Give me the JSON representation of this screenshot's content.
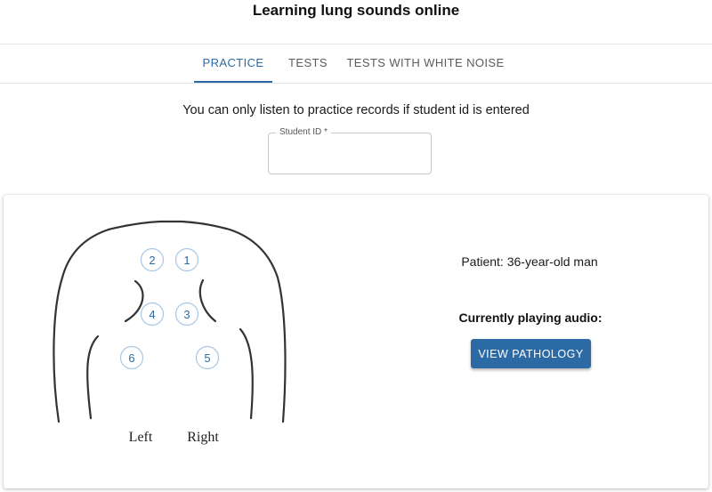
{
  "app": {
    "title": "Learning lung sounds online"
  },
  "tabs": [
    {
      "label": "PRACTICE",
      "active": true
    },
    {
      "label": "TESTS",
      "active": false
    },
    {
      "label": "TESTS WITH WHITE NOISE",
      "active": false
    }
  ],
  "practice": {
    "instruction": "You can only listen to practice records if student id is entered",
    "student_id": {
      "label": "Student ID *",
      "value": ""
    }
  },
  "diagram": {
    "points": [
      "1",
      "2",
      "3",
      "4",
      "5",
      "6"
    ],
    "side_labels": {
      "left": "Left",
      "right": "Right"
    }
  },
  "patient_panel": {
    "patient": "Patient: 36-year-old man",
    "playing": "Currently playing audio:",
    "view_button": "VIEW PATHOLOGY"
  },
  "colors": {
    "accent": "#2c6aa6",
    "outline": "#333333"
  }
}
